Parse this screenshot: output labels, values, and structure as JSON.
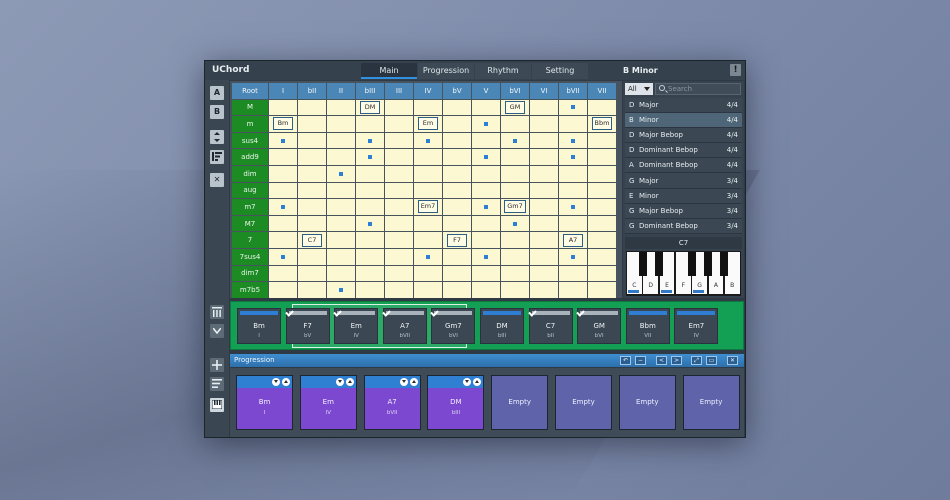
{
  "app": {
    "title": "UChord",
    "scale_title": "B Minor",
    "warn_label": "!"
  },
  "tabs": [
    {
      "label": "Main"
    },
    {
      "label": "Progression"
    },
    {
      "label": "Rhythm"
    },
    {
      "label": "Setting"
    }
  ],
  "left_tools": {
    "a_label": "A",
    "b_label": "B",
    "close_label": "✕"
  },
  "grid": {
    "root_label": "Root",
    "degrees": [
      "I",
      "bII",
      "II",
      "bIII",
      "III",
      "IV",
      "bV",
      "V",
      "bVI",
      "VI",
      "bVII",
      "VII"
    ],
    "rows": [
      {
        "label": "M",
        "cells": [
          "",
          "",
          "",
          "DM",
          "",
          "",
          "",
          "",
          "GM",
          "",
          "•",
          ""
        ]
      },
      {
        "label": "m",
        "cells": [
          "Bm",
          "",
          "",
          "",
          "",
          "Em",
          "",
          "•",
          "",
          "",
          "",
          "Bbm"
        ]
      },
      {
        "label": "sus4",
        "cells": [
          "•",
          "",
          "",
          "•",
          "",
          "•",
          "",
          "",
          "•",
          "",
          "•",
          ""
        ]
      },
      {
        "label": "add9",
        "cells": [
          "",
          "",
          "",
          "•",
          "",
          "",
          "",
          "•",
          "",
          "",
          "•",
          ""
        ]
      },
      {
        "label": "dim",
        "cells": [
          "",
          "",
          "•",
          "",
          "",
          "",
          "",
          "",
          "",
          "",
          "",
          ""
        ]
      },
      {
        "label": "aug",
        "cells": [
          "",
          "",
          "",
          "",
          "",
          "",
          "",
          "",
          "",
          "",
          "",
          ""
        ]
      },
      {
        "label": "m7",
        "cells": [
          "•",
          "",
          "",
          "",
          "",
          "Em7",
          "",
          "•",
          "Gm7",
          "",
          "•",
          ""
        ]
      },
      {
        "label": "M7",
        "cells": [
          "",
          "",
          "",
          "•",
          "",
          "",
          "",
          "",
          "•",
          "",
          "",
          ""
        ]
      },
      {
        "label": "7",
        "cells": [
          "",
          "C7",
          "",
          "",
          "",
          "",
          "F7",
          "",
          "",
          "",
          "A7",
          ""
        ]
      },
      {
        "label": "7sus4",
        "cells": [
          "•",
          "",
          "",
          "",
          "",
          "•",
          "",
          "•",
          "",
          "",
          "•",
          ""
        ]
      },
      {
        "label": "dim7",
        "cells": [
          "",
          "",
          "",
          "",
          "",
          "",
          "",
          "",
          "",
          "",
          "",
          ""
        ]
      },
      {
        "label": "m7b5",
        "cells": [
          "",
          "",
          "•",
          "",
          "",
          "",
          "",
          "",
          "",
          "",
          "",
          ""
        ]
      }
    ]
  },
  "scales": {
    "filter_value": "All",
    "search_placeholder": "Search",
    "items": [
      {
        "key": "D",
        "name": "Major",
        "count": "4/4",
        "selected": false
      },
      {
        "key": "B",
        "name": "Minor",
        "count": "4/4",
        "selected": true
      },
      {
        "key": "D",
        "name": "Major Bebop",
        "count": "4/4",
        "selected": false
      },
      {
        "key": "D",
        "name": "Dominant Bebop",
        "count": "4/4",
        "selected": false
      },
      {
        "key": "A",
        "name": "Dominant Bebop",
        "count": "4/4",
        "selected": false
      },
      {
        "key": "G",
        "name": "Major",
        "count": "3/4",
        "selected": false
      },
      {
        "key": "E",
        "name": "Minor",
        "count": "3/4",
        "selected": false
      },
      {
        "key": "G",
        "name": "Major Bebop",
        "count": "3/4",
        "selected": false
      },
      {
        "key": "G",
        "name": "Dominant Bebop",
        "count": "3/4",
        "selected": false
      }
    ]
  },
  "piano": {
    "chord": "C7",
    "white_keys": [
      "C",
      "D",
      "E",
      "F",
      "G",
      "A",
      "B"
    ],
    "highlighted": [
      "C",
      "E",
      "G"
    ]
  },
  "palette": [
    {
      "name": "Bm",
      "degree": "I",
      "checked": false
    },
    {
      "name": "F7",
      "degree": "bV",
      "checked": true
    },
    {
      "name": "Em",
      "degree": "IV",
      "checked": true
    },
    {
      "name": "A7",
      "degree": "bVII",
      "checked": true
    },
    {
      "name": "Gm7",
      "degree": "bVI",
      "checked": true
    },
    {
      "name": "DM",
      "degree": "bIII",
      "checked": false
    },
    {
      "name": "C7",
      "degree": "bII",
      "checked": true
    },
    {
      "name": "GM",
      "degree": "bVI",
      "checked": true
    },
    {
      "name": "Bbm",
      "degree": "VII",
      "checked": false
    },
    {
      "name": "Em7",
      "degree": "IV",
      "checked": false
    }
  ],
  "progression": {
    "title": "Progression",
    "buttons": [
      "↶",
      "−",
      "<",
      ">",
      "⤢",
      "▭",
      "✕"
    ],
    "slots": [
      {
        "name": "Bm",
        "degree": "I",
        "empty": false
      },
      {
        "name": "Em",
        "degree": "IV",
        "empty": false
      },
      {
        "name": "A7",
        "degree": "bVII",
        "empty": false
      },
      {
        "name": "DM",
        "degree": "bIII",
        "empty": false
      },
      {
        "name": "Empty",
        "degree": "",
        "empty": true
      },
      {
        "name": "Empty",
        "degree": "",
        "empty": true
      },
      {
        "name": "Empty",
        "degree": "",
        "empty": true
      },
      {
        "name": "Empty",
        "degree": "",
        "empty": true
      }
    ]
  }
}
